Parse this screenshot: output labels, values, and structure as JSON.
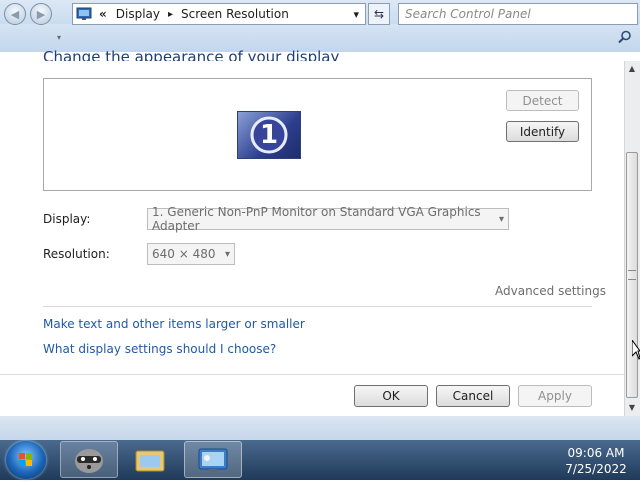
{
  "window": {
    "controls": {
      "minimize": "—",
      "maximize": "▫",
      "close": "✕"
    }
  },
  "navbar": {
    "back_icon": "back-arrow-icon",
    "forward_icon": "forward-arrow-icon",
    "breadcrumb_chevrons": "«",
    "breadcrumb": [
      "Display",
      "Screen Resolution"
    ],
    "breadcrumb_sep": "▸",
    "dropdown_arrow": "▾",
    "refresh_glyph": "⇆",
    "search_placeholder": "Search Control Panel"
  },
  "main": {
    "heading_partial": "Change the appearance of your display",
    "monitor_number": "1",
    "detect_label": "Detect",
    "identify_label": "Identify",
    "display_label": "Display:",
    "display_value": "1. Generic Non-PnP Monitor on Standard VGA Graphics Adapter",
    "resolution_label": "Resolution:",
    "resolution_value": "640 × 480",
    "advanced_settings": "Advanced settings",
    "link1": "Make text and other items larger or smaller",
    "link2": "What display settings should I choose?",
    "ok_label": "OK",
    "cancel_label": "Cancel",
    "apply_label": "Apply"
  },
  "taskbar": {
    "time": "09:06 AM",
    "date": "7/25/2022"
  },
  "colors": {
    "link": "#1e5aa8",
    "taskbar": "#2a4a70",
    "monitor_tile": "#3b4fa0"
  }
}
